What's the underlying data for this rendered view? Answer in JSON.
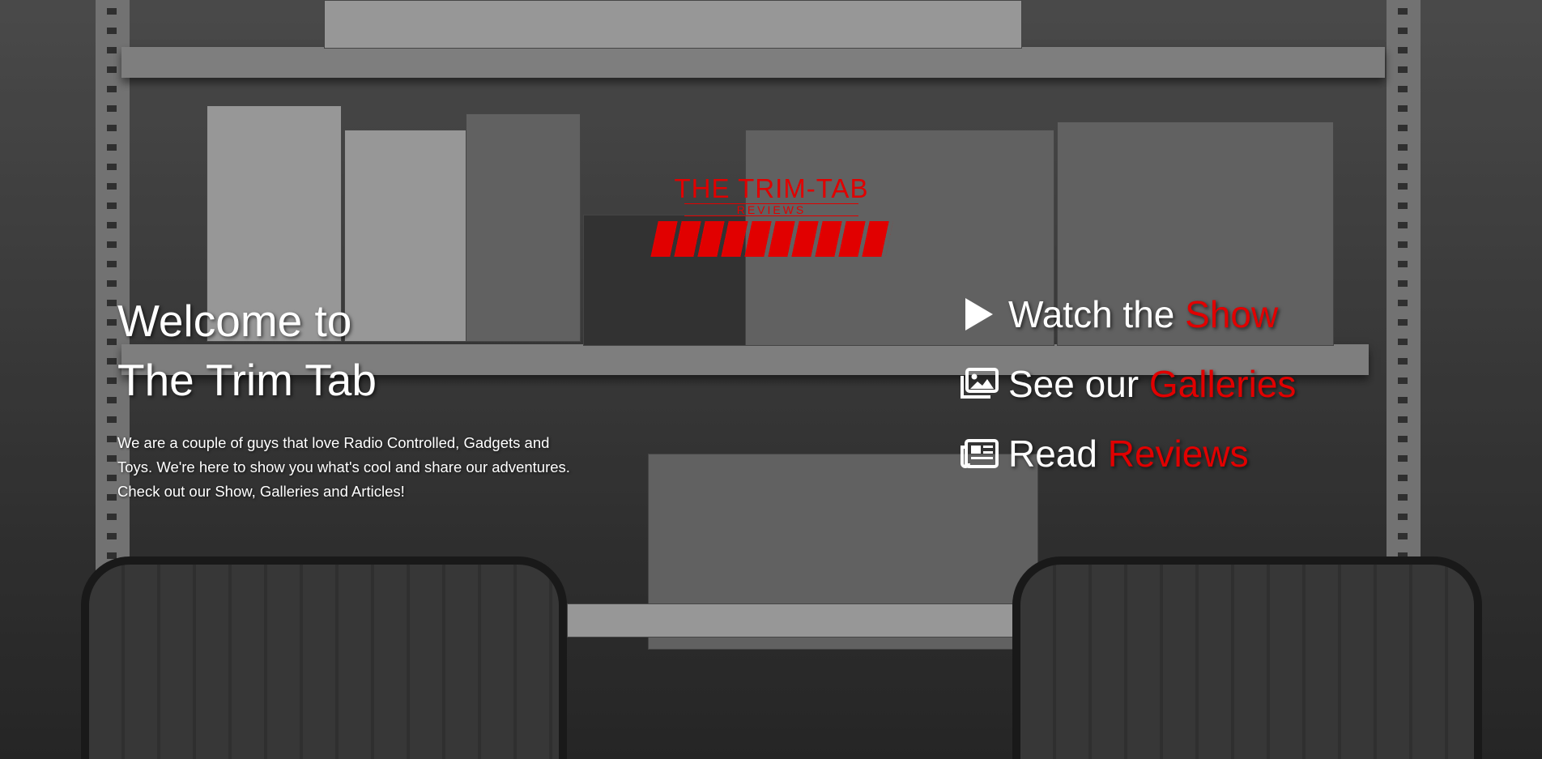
{
  "logo": {
    "title": "THE TRIM-TAB",
    "subtitle": "REVIEWS"
  },
  "welcome": {
    "line1": "Welcome to",
    "line2": "The Trim Tab",
    "body": "We are a couple of guys that love Radio Controlled, Gadgets and Toys. We're here to show you what's cool and share our adventures. Check out our Show, Galleries and Articles!"
  },
  "links": [
    {
      "prefix": "Watch the ",
      "accent": "Show",
      "icon": "play-icon"
    },
    {
      "prefix": "See our ",
      "accent": "Galleries",
      "icon": "image-gallery-icon"
    },
    {
      "prefix": "Read ",
      "accent": "Reviews",
      "icon": "newspaper-icon"
    }
  ],
  "colors": {
    "accent": "#e10000",
    "text": "#ffffff"
  }
}
